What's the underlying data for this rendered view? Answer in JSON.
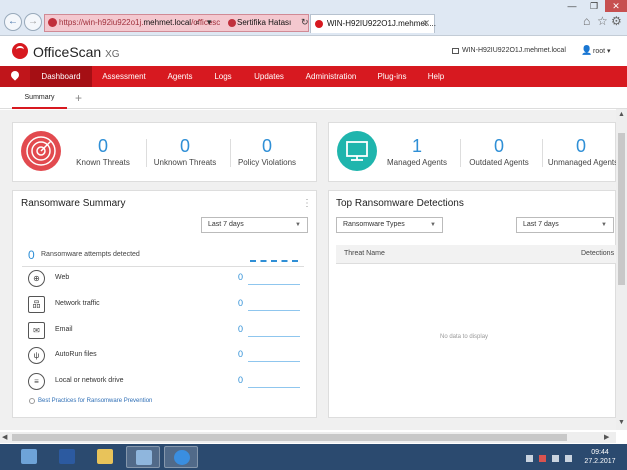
{
  "window": {
    "minimize_glyph": "—",
    "restore_glyph": "❐",
    "close_glyph": "✕"
  },
  "browser": {
    "back_glyph": "←",
    "forward_glyph": "→",
    "url_prefix": "https://win-h92iu922o1j.",
    "url_domain": "mehmet.local",
    "url_suffix": "/officesc",
    "cert_error": "Sertifika Hatası",
    "search_glyph": "⌕",
    "dropdown_glyph": "▾",
    "refresh_glyph": "↻",
    "tab_title": "WIN-H92IU922O1J.mehmet....",
    "tab_close": "✕",
    "home_glyph": "⌂",
    "favorites_glyph": "☆",
    "tools_glyph": "⚙"
  },
  "header": {
    "brand": "OfficeScan",
    "brand_suffix": "XG",
    "server": "WIN-H92IU922O1J.mehmet.local",
    "user_glyph": "👤",
    "user": "root",
    "user_caret": "▾"
  },
  "menu": [
    {
      "label": "Dashboard"
    },
    {
      "label": "Assessment"
    },
    {
      "label": "Agents"
    },
    {
      "label": "Logs"
    },
    {
      "label": "Updates"
    },
    {
      "label": "Administration"
    },
    {
      "label": "Plug-ins"
    },
    {
      "label": "Help"
    }
  ],
  "subtabs": {
    "summary": "Summary",
    "add": "+"
  },
  "threats": {
    "known_value": "0",
    "known_label": "Known Threats",
    "unknown_value": "0",
    "unknown_label": "Unknown Threats",
    "policy_value": "0",
    "policy_label": "Policy Violations"
  },
  "agents": {
    "managed_value": "1",
    "managed_label": "Managed Agents",
    "outdated_value": "0",
    "outdated_label": "Outdated Agents",
    "unmanaged_value": "0",
    "unmanaged_label": "Unmanaged Agents"
  },
  "ransomware": {
    "title": "Ransomware Summary",
    "menu_glyph": "⋮",
    "period": "Last 7 days",
    "attempts_value": "0",
    "attempts_label": "Ransomware attempts detected",
    "rows": [
      {
        "label": "Web",
        "value": "0",
        "icon": "globe-icon"
      },
      {
        "label": "Network traffic",
        "value": "0",
        "icon": "network-icon"
      },
      {
        "label": "Email",
        "value": "0",
        "icon": "envelope-icon"
      },
      {
        "label": "AutoRun files",
        "value": "0",
        "icon": "usb-icon"
      },
      {
        "label": "Local or network drive",
        "value": "0",
        "icon": "drive-icon"
      }
    ],
    "link": "Best Practices for Ransomware Prevention"
  },
  "top_detections": {
    "title": "Top Ransomware Detections",
    "filter": "Ransomware Types",
    "period": "Last 7 days",
    "col_threat": "Threat Name",
    "col_detections": "Detections",
    "empty": "No data to display"
  },
  "taskbar": {
    "time": "09:44",
    "date": "27.2.2017"
  },
  "colors": {
    "brand_red": "#d71920",
    "accent_blue": "#2f8fd6",
    "teal": "#1fb5ad"
  }
}
